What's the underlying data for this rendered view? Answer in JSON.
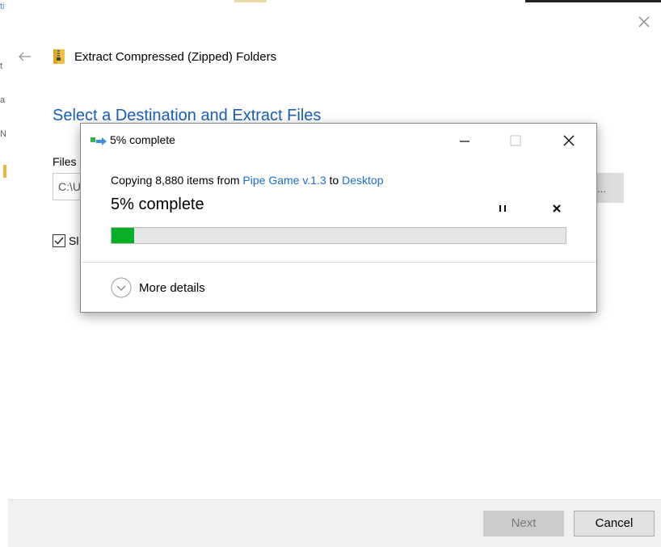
{
  "wizard": {
    "title": "Extract Compressed (Zipped) Folders",
    "heading": "Select a Destination and Extract Files",
    "files_label": "Files",
    "path_value": "C:\\U",
    "browse_label": "...",
    "show_label": "Sl",
    "show_checked": true
  },
  "footer": {
    "next_label": "Next",
    "cancel_label": "Cancel"
  },
  "dialog": {
    "title": "5% complete",
    "copy_prefix": "Copying 8,880 items from ",
    "source": "Pipe Game v.1.3",
    "copy_middle": " to ",
    "destination": "Desktop",
    "status": "5% complete",
    "progress_percent": 5,
    "more_details_label": "More details"
  },
  "colors": {
    "heading_blue": "#1a5fb4",
    "link_blue": "#1a6dc4",
    "progress_green": "#06b025"
  },
  "icons": {
    "window_close": "close-icon",
    "back": "back-arrow-icon",
    "zip": "zip-folder-icon",
    "copy": "copy-progress-icon",
    "pause": "pause-icon",
    "stop": "stop-icon",
    "expand": "chevron-down-icon"
  }
}
